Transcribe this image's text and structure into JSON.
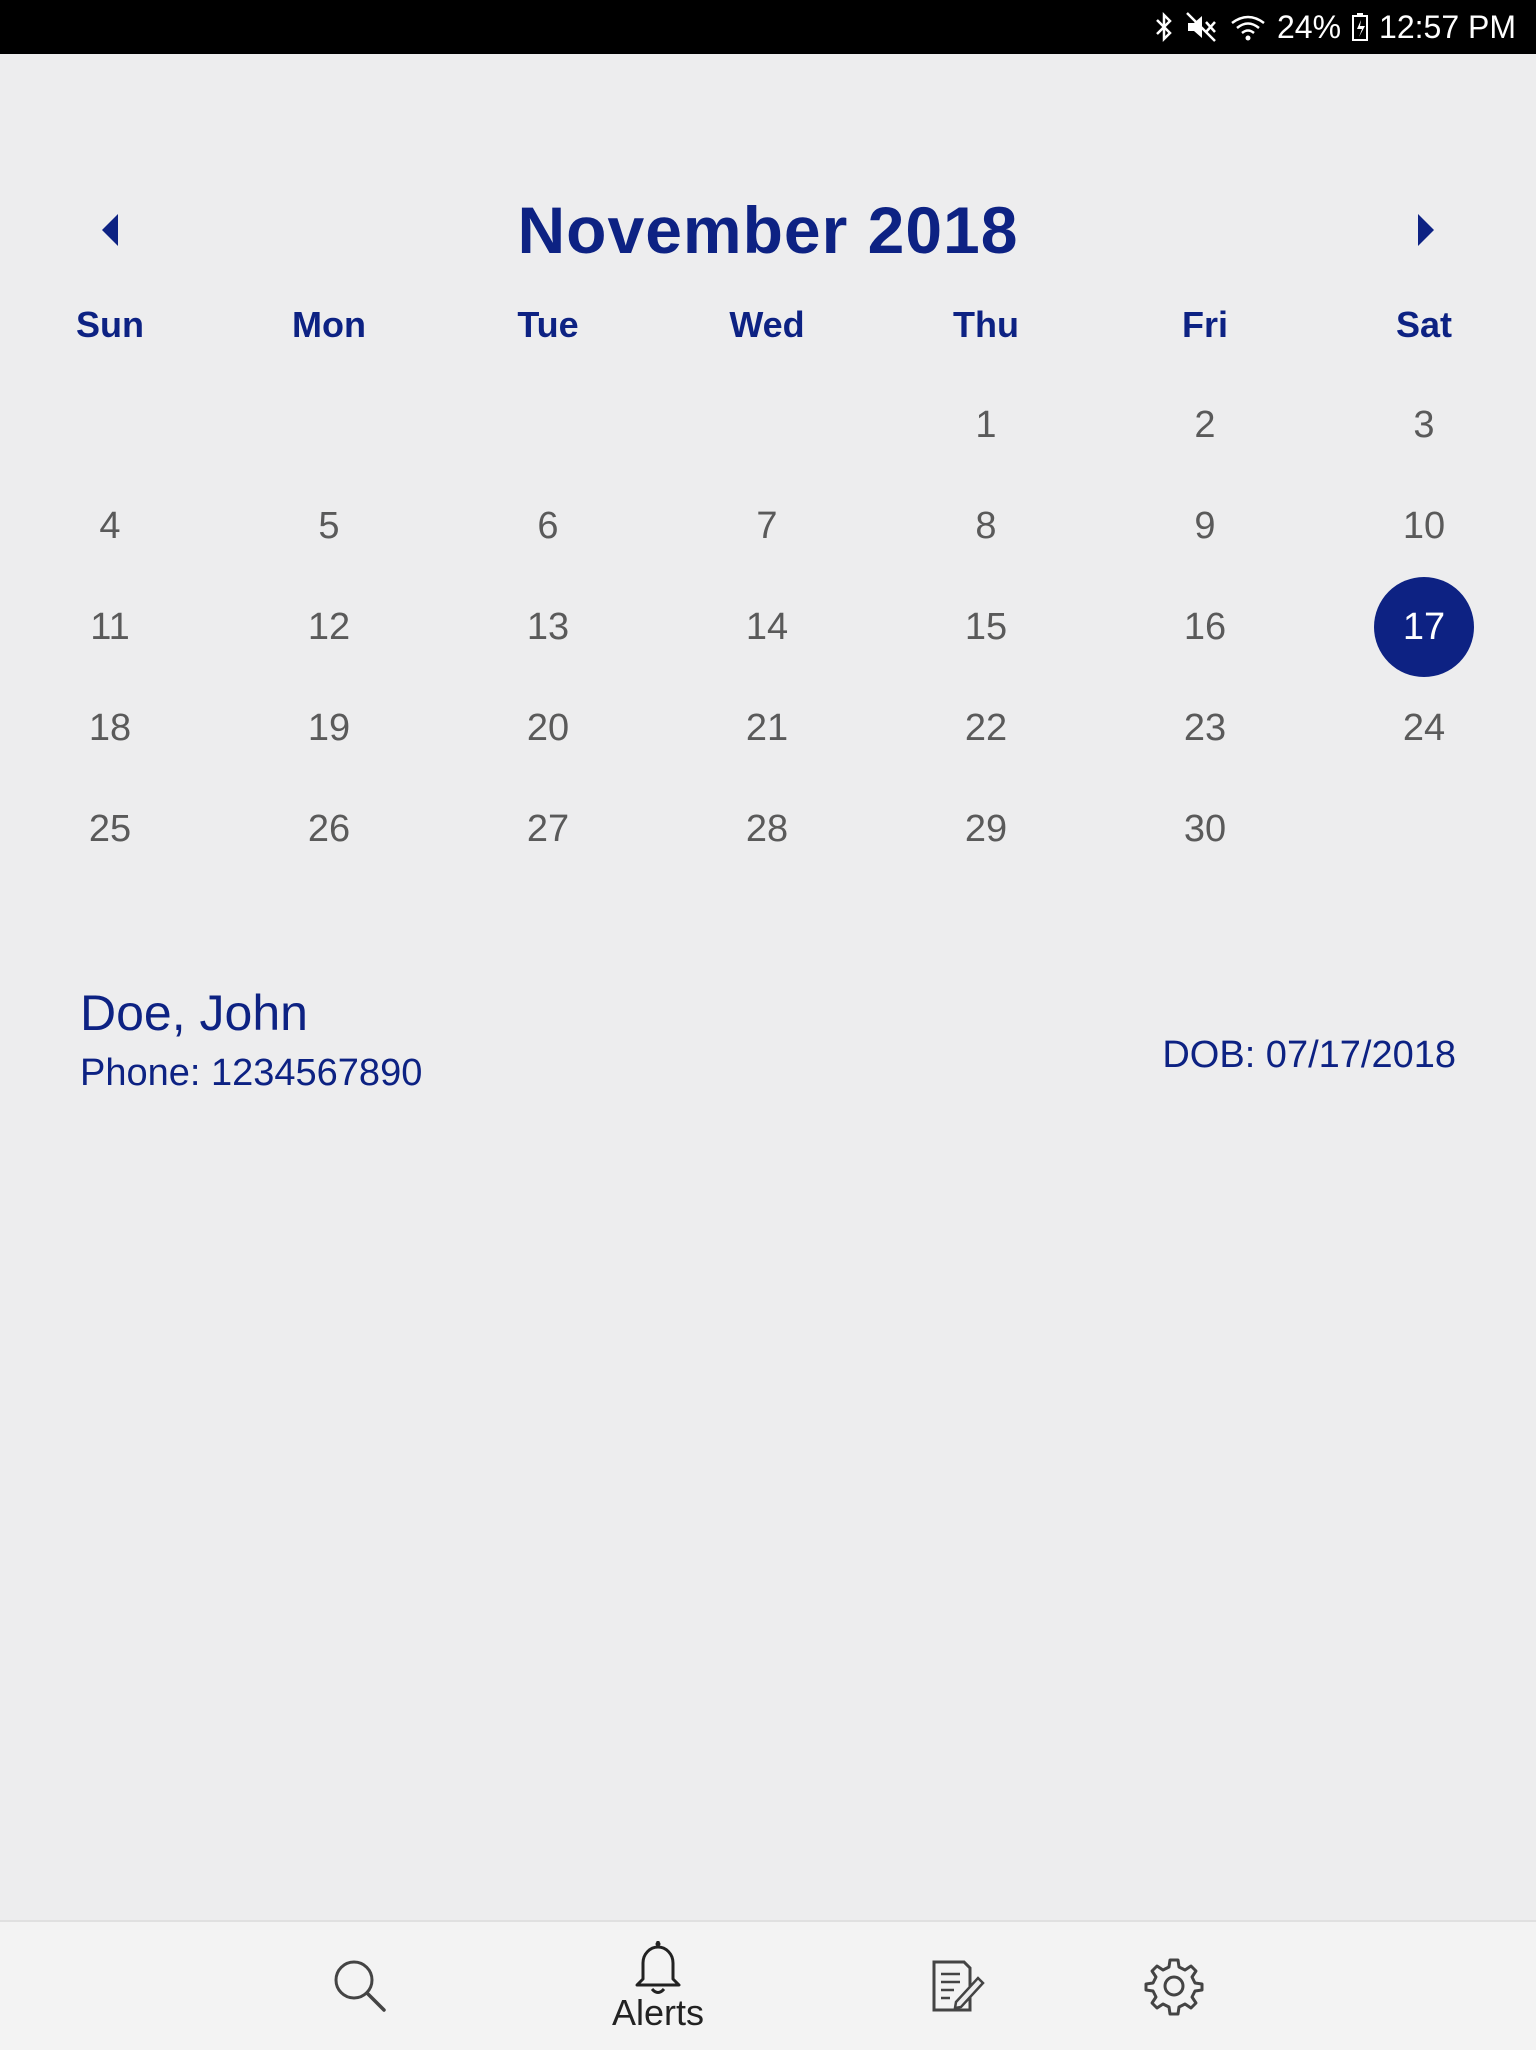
{
  "status_bar": {
    "battery": "24%",
    "time": "12:57 PM"
  },
  "calendar": {
    "month_title": "November 2018",
    "weekdays": [
      "Sun",
      "Mon",
      "Tue",
      "Wed",
      "Thu",
      "Fri",
      "Sat"
    ],
    "first_weekday_index": 4,
    "days_in_month": 30,
    "selected_day": 17
  },
  "patient": {
    "name": "Doe, John",
    "phone": "Phone: 1234567890",
    "dob": "DOB: 07/17/2018"
  },
  "bottom_nav": {
    "items": [
      {
        "icon": "search-icon",
        "label": ""
      },
      {
        "icon": "bell-icon",
        "label": "Alerts"
      },
      {
        "icon": "notes-icon",
        "label": ""
      },
      {
        "icon": "gear-icon",
        "label": ""
      }
    ]
  },
  "colors": {
    "accent": "#0d2283",
    "day_text": "#5a5a5a",
    "background": "#ededee"
  }
}
